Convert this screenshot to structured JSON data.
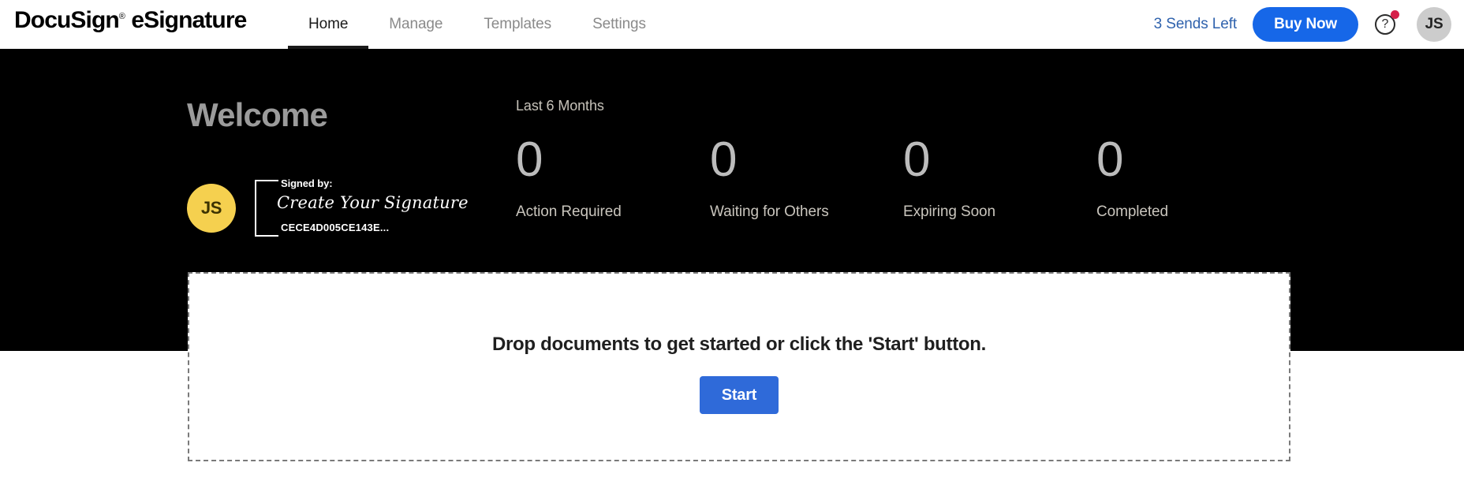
{
  "brand": {
    "name": "DocuSign",
    "registered": "®",
    "product": "eSignature"
  },
  "nav": {
    "tabs": [
      {
        "label": "Home",
        "active": true
      },
      {
        "label": "Manage",
        "active": false
      },
      {
        "label": "Templates",
        "active": false
      },
      {
        "label": "Settings",
        "active": false
      }
    ]
  },
  "topbar_right": {
    "sends_left": "3 Sends Left",
    "buy_now": "Buy Now",
    "help_icon": "question-mark-icon",
    "help_glyph": "?",
    "notification_dot_color": "#d5214a",
    "avatar_initials": "JS"
  },
  "hero": {
    "welcome": "Welcome",
    "background_color": "#000000",
    "signature": {
      "avatar_initials": "JS",
      "avatar_color": "#f5d04f",
      "signed_by_label": "Signed by:",
      "signature_text": "Create Your Signature",
      "envelope_id": "CECE4D005CE143E..."
    }
  },
  "stats": {
    "period_label": "Last 6 Months",
    "items": [
      {
        "value": "0",
        "label": "Action Required"
      },
      {
        "value": "0",
        "label": "Waiting for Others"
      },
      {
        "value": "0",
        "label": "Expiring Soon"
      },
      {
        "value": "0",
        "label": "Completed"
      }
    ]
  },
  "dropzone": {
    "message": "Drop documents to get started or click the 'Start' button.",
    "start_label": "Start",
    "accent_color": "#2f6ad9"
  }
}
